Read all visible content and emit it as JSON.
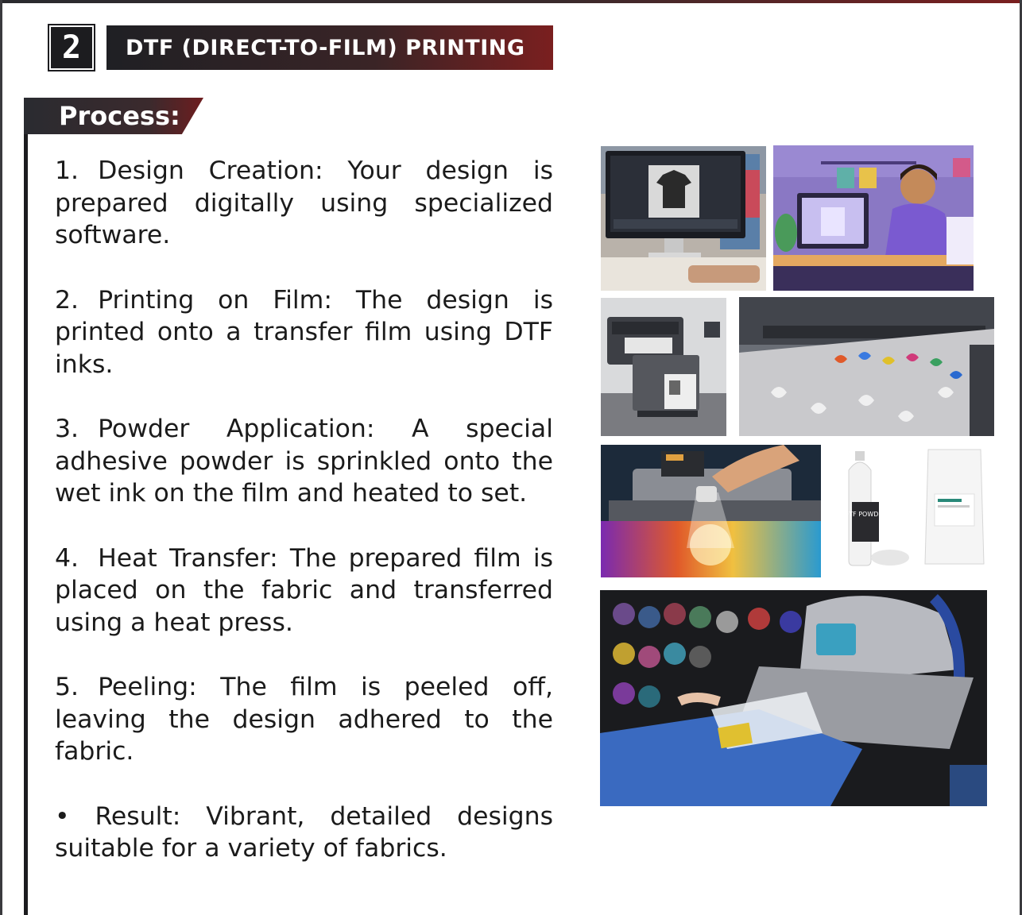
{
  "section": {
    "number": "2",
    "title": "DTF (DIRECT-TO-FILM) PRINTING"
  },
  "process": {
    "heading": "Process:",
    "steps": [
      {
        "num": "1.",
        "text": "Design Creation: Your design is prepared digitally using specialized software."
      },
      {
        "num": "2.",
        "text": "Printing on Film: The design is printed onto a transfer film using DTF inks."
      },
      {
        "num": "3.",
        "text": "Powder Application: A special adhesive powder is sprinkled onto the wet ink on the film and heated to set."
      },
      {
        "num": "4.",
        "text": "Heat Transfer: The prepared film is placed on the fabric and transferred using a heat press."
      },
      {
        "num": "5.",
        "text": "Peeling: The film is peeled off, leaving the design adhered to the fabric."
      }
    ],
    "result": "• Result: Vibrant, detailed designs suitable for a variety of fabrics."
  },
  "photos": {
    "powder_bottle_label": "DTF POWDER"
  },
  "colors": {
    "dark": "#1c1c1f",
    "accent_red": "#7a1f1f",
    "text": "#1b1b1b"
  }
}
